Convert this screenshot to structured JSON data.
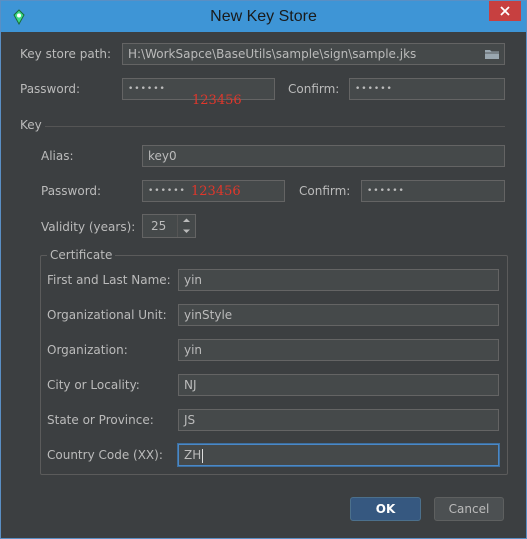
{
  "window": {
    "title": "New Key Store"
  },
  "keystore": {
    "path_label": "Key store path:",
    "path_value": "H:\\WorkSapce\\BaseUtils\\sample\\sign\\sample.jks",
    "password_label": "Password:",
    "password_value": "••••••",
    "confirm_label": "Confirm:",
    "confirm_value": "••••••",
    "password_note": "123456"
  },
  "key": {
    "section_label": "Key",
    "alias_label": "Alias:",
    "alias_value": "key0",
    "password_label": "Password:",
    "password_value": "••••••",
    "password_note": "123456",
    "confirm_label": "Confirm:",
    "confirm_value": "••••••",
    "validity_label": "Validity (years):",
    "validity_value": "25"
  },
  "certificate": {
    "section_label": "Certificate",
    "fields": [
      {
        "label": "First and Last Name:",
        "value": "yin"
      },
      {
        "label": "Organizational Unit:",
        "value": "yinStyle"
      },
      {
        "label": "Organization:",
        "value": "yin"
      },
      {
        "label": "City or Locality:",
        "value": "NJ"
      },
      {
        "label": "State or Province:",
        "value": "JS"
      },
      {
        "label": "Country Code (XX):",
        "value": "ZH"
      }
    ]
  },
  "buttons": {
    "ok": "OK",
    "cancel": "Cancel"
  },
  "icons": {
    "app": "android-icon",
    "close": "close-icon",
    "browse": "folder-icon"
  },
  "colors": {
    "titlebar": "#3e95d6",
    "background": "#3c3f41",
    "close": "#c74040",
    "annotation": "#e0372b",
    "ok": "#365880"
  }
}
